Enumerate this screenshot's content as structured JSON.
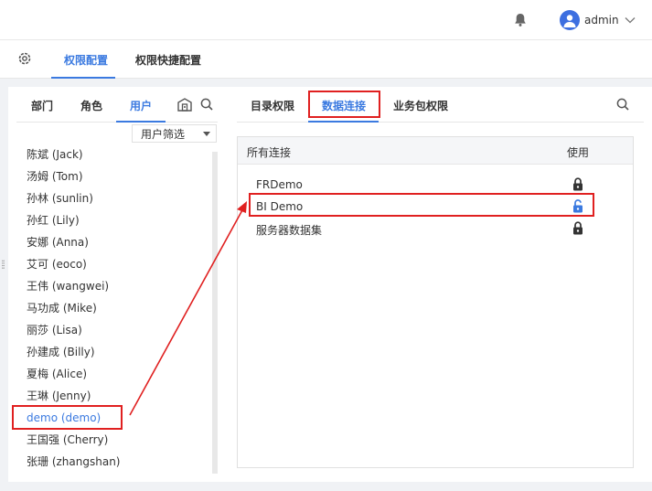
{
  "header": {
    "user_name": "admin"
  },
  "top_tabs": [
    {
      "label": "权限配置",
      "active": true
    },
    {
      "label": "权限快捷配置",
      "active": false
    }
  ],
  "left_panel": {
    "tabs": [
      {
        "label": "部门"
      },
      {
        "label": "角色"
      },
      {
        "label": "用户",
        "active": true
      }
    ],
    "filter_label": "用户筛选",
    "users": [
      "陈斌 (Jack)",
      "汤姆 (Tom)",
      "孙林 (sunlin)",
      "孙红 (Lily)",
      "安娜 (Anna)",
      "艾可 (eoco)",
      "王伟 (wangwei)",
      "马功成 (Mike)",
      "丽莎 (Lisa)",
      "孙建成 (Billy)",
      "夏梅 (Alice)",
      "王琳 (Jenny)",
      "demo (demo)",
      "王国强 (Cherry)",
      "张珊 (zhangshan)"
    ],
    "selected_user": "demo (demo)"
  },
  "right_panel": {
    "tabs": [
      {
        "label": "目录权限"
      },
      {
        "label": "数据连接",
        "active": true
      },
      {
        "label": "业务包权限"
      }
    ],
    "table_header": {
      "name": "所有连接",
      "use": "使用"
    },
    "connections": [
      {
        "name": "FRDemo",
        "icon": "lock-icon",
        "unlocked": false
      },
      {
        "name": "BI Demo",
        "icon": "unlock-icon",
        "unlocked": true
      },
      {
        "name": "服务器数据集",
        "icon": "lock-icon",
        "unlocked": false
      }
    ]
  },
  "colors": {
    "accent": "#3b7ae0",
    "annotation": "#e02020"
  }
}
